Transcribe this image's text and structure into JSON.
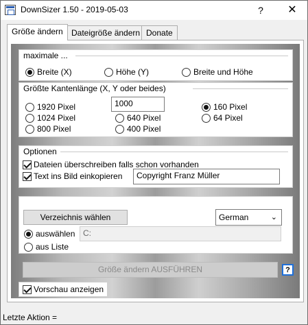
{
  "window": {
    "title": "DownSizer  1.50 - 2019-05-03",
    "help_symbol": "?",
    "close_symbol": "✕"
  },
  "tabs": [
    {
      "label": "Größe ändern",
      "active": true
    },
    {
      "label": "Dateigröße ändern",
      "active": false
    },
    {
      "label": "Donate",
      "active": false
    }
  ],
  "max_group": {
    "title": "maximale ...",
    "options": [
      {
        "label": "Breite (X)",
        "selected": true
      },
      {
        "label": "Höhe (Y)",
        "selected": false
      },
      {
        "label": "Breite und Höhe",
        "selected": false
      }
    ]
  },
  "edge_group": {
    "title": "Größte Kantenlänge (X, Y oder beides)",
    "custom_value": "1000",
    "options": [
      {
        "label": "1920 Pixel",
        "selected": false
      },
      {
        "label": "160 Pixel",
        "selected": true
      },
      {
        "label": "1024 Pixel",
        "selected": false
      },
      {
        "label": "640 Pixel",
        "selected": false
      },
      {
        "label": "64 Pixel",
        "selected": false
      },
      {
        "label": "800 Pixel",
        "selected": false
      },
      {
        "label": "400 Pixel",
        "selected": false
      }
    ]
  },
  "options_group": {
    "title": "Optionen",
    "overwrite_label": "Dateien überschreiben falls schon vorhanden",
    "overwrite_checked": true,
    "copy_text_label": "Text ins Bild einkopieren",
    "copy_text_checked": true,
    "copy_text_value": "Copyright Franz Müller"
  },
  "dir_group": {
    "choose_dir_label": "Verzeichnis wählen",
    "language": "German",
    "choose_label": "auswählen",
    "choose_selected": true,
    "path_value": "C:",
    "list_label": "aus Liste",
    "list_selected": false
  },
  "execute": {
    "label": "Größe ändern AUSFÜHREN",
    "help_label": "?"
  },
  "preview": {
    "label": "Vorschau anzeigen",
    "checked": true
  },
  "status": {
    "text": "Letzte Aktion ="
  }
}
